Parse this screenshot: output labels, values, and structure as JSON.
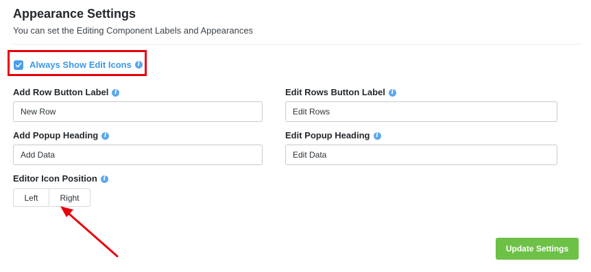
{
  "header": {
    "title": "Appearance Settings",
    "subtitle": "You can set the Editing Component Labels and Appearances"
  },
  "always_show_edit_icons": {
    "label": "Always Show Edit Icons",
    "checked": true
  },
  "fields": {
    "add_row_label": {
      "label": "Add Row Button Label",
      "value": "New Row"
    },
    "edit_rows_label": {
      "label": "Edit Rows Button Label",
      "value": "Edit Rows"
    },
    "add_popup_heading": {
      "label": "Add Popup Heading",
      "value": "Add Data"
    },
    "edit_popup_heading": {
      "label": "Edit Popup Heading",
      "value": "Edit Data"
    }
  },
  "editor_icon_position": {
    "label": "Editor Icon Position",
    "options": [
      "Left",
      "Right"
    ]
  },
  "update_button": "Update Settings",
  "colors": {
    "accent_blue": "#3a97e8",
    "annotation_red": "#e8000a",
    "update_green": "#6dc147"
  },
  "icons": {
    "info": "info-icon",
    "check": "check-icon"
  },
  "info_glyph": "i"
}
